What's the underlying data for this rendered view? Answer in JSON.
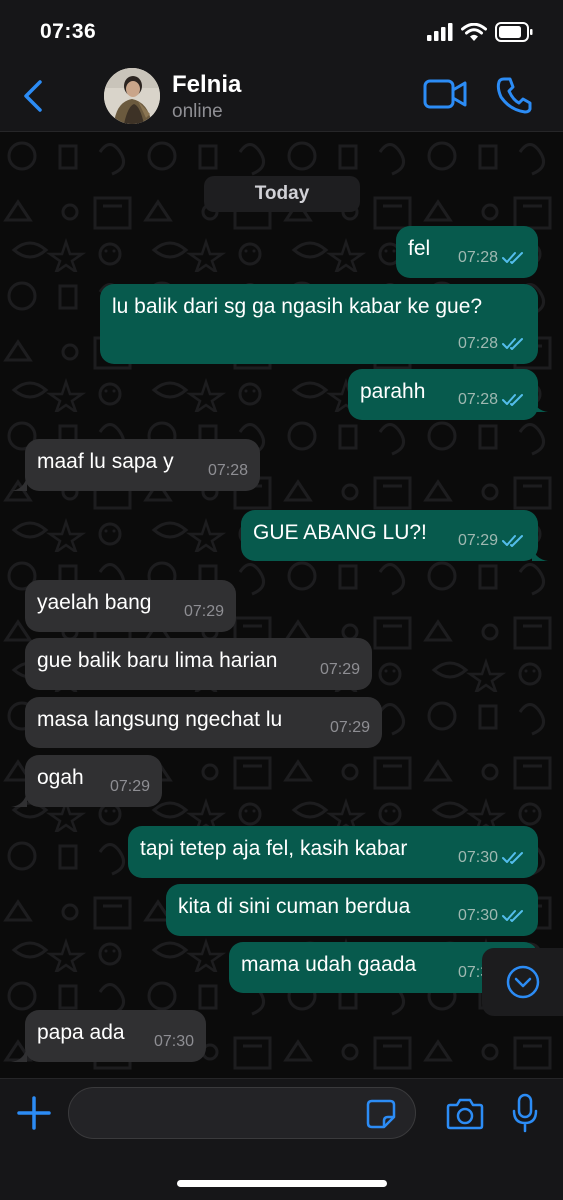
{
  "status_bar": {
    "time": "07:36"
  },
  "header": {
    "contact_name": "Felnia",
    "contact_status": "online",
    "accent_color": "#2c8cf5"
  },
  "chat": {
    "date_label": "Today",
    "messages": [
      {
        "direction": "out",
        "text": "fel",
        "time": "07:28",
        "read": true
      },
      {
        "direction": "out",
        "text": "lu balik dari sg ga ngasih kabar ke gue?",
        "time": "07:28",
        "read": true
      },
      {
        "direction": "out",
        "text": "parahh",
        "time": "07:28",
        "read": true
      },
      {
        "direction": "in",
        "text": "maaf lu sapa y",
        "time": "07:28"
      },
      {
        "direction": "out",
        "text": "GUE ABANG LU?!",
        "time": "07:29",
        "read": true
      },
      {
        "direction": "in",
        "text": "yaelah bang",
        "time": "07:29"
      },
      {
        "direction": "in",
        "text": "gue balik baru lima harian",
        "time": "07:29"
      },
      {
        "direction": "in",
        "text": "masa langsung ngechat lu",
        "time": "07:29"
      },
      {
        "direction": "in",
        "text": "ogah",
        "time": "07:29"
      },
      {
        "direction": "out",
        "text": "tapi tetep aja fel, kasih kabar",
        "time": "07:30",
        "read": true
      },
      {
        "direction": "out",
        "text": "kita di sini cuman berdua",
        "time": "07:30",
        "read": true
      },
      {
        "direction": "out",
        "text": "mama udah gaada",
        "time": "07:30",
        "read": true
      },
      {
        "direction": "in",
        "text": "papa ada",
        "time": "07:30"
      }
    ],
    "outgoing_color": "#075a4d",
    "incoming_color": "#303032",
    "read_tick_color": "#53bdeb"
  },
  "input_bar": {
    "value": "",
    "placeholder": ""
  },
  "icons": {
    "back": "chevron-left-icon",
    "video": "video-call-icon",
    "voice": "phone-icon",
    "attach": "plus-icon",
    "sticker": "sticker-icon",
    "camera": "camera-icon",
    "mic": "microphone-icon",
    "scroll": "chevron-down-circle-icon"
  }
}
